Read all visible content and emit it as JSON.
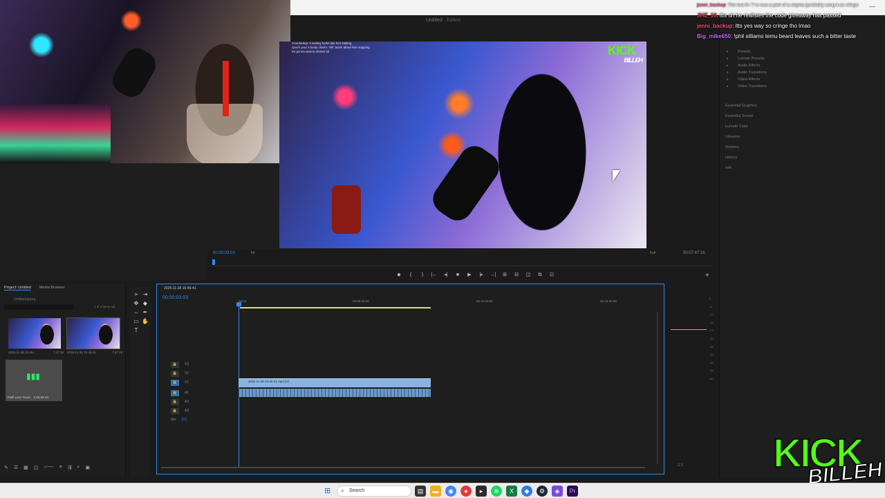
{
  "window": {
    "project_title": "Untitled",
    "edited_label": "Edited"
  },
  "chat": [
    {
      "user": "jenni_backup",
      "color": "#ff4f7a",
      "text": ": The last 6 / 7 is now a part of a stigma (probably song it as village"
    },
    {
      "user": "JHZ_16",
      "color": "#ff3c3c",
      "text": ": ltts oh he realisies the code giveaway has passed"
    },
    {
      "user": "jenni_backup",
      "color": "#ff4f7a",
      "text": ": ltts yes way so cringe tho lmao"
    },
    {
      "user": "Big_mike650",
      "color": "#c86bff",
      "text": ": !phil silliams temu beard leaves such a bitter taste"
    }
  ],
  "program_monitor": {
    "timecode": "00:00:03:03",
    "fit": "Fit",
    "resolution": "Full",
    "duration": "00:07:47:16",
    "overlay_lines": [
      "Jcrackedup: it lowkey looks like he's baking",
      "Jpoch your a lucky charm. Tell Justin about him mapping",
      "he gonna wanna stream lol"
    ],
    "logo_top": "KICK",
    "logo_sub": "BILLEH",
    "transport": [
      "◆",
      "{",
      "}",
      "|←",
      "◂|",
      "■",
      "▶",
      "|▸",
      "→|",
      "⊞",
      "⊟",
      "◫",
      "⧉",
      "⊡"
    ]
  },
  "effects": {
    "tree": [
      "Presets",
      "Lumetri Presets",
      "Audio Effects",
      "Audio Transitions",
      "Video Effects",
      "Video Transitions"
    ],
    "panels": [
      "Essential Graphics",
      "Essential Sound",
      "Lumetri Color",
      "Libraries",
      "Markers",
      "History",
      "Info"
    ]
  },
  "project": {
    "tabs": [
      "Project: Untitled",
      "Media Browser"
    ],
    "project_file": "Untitled.prproj",
    "items_count": "1 of 3 items sel.",
    "clips": [
      {
        "name": "2025-11-28 15-45-...",
        "duration": "7:47:16"
      },
      {
        "name": "2025-11-28 15-45-41",
        "duration": "7:47:16"
      }
    ],
    "audio_clip": {
      "name": "Path Less Trave...",
      "duration": "2:46:59:43"
    }
  },
  "timeline": {
    "sequence_name": "2025-11-28 15-45-41",
    "timecode": "00:00:03:03",
    "ruler": [
      "00:00",
      "00:05:00:00",
      "00:10:00:00",
      "00:15:00:00"
    ],
    "tracks": [
      {
        "label": "V3"
      },
      {
        "label": "V2"
      },
      {
        "label": "V1"
      },
      {
        "label": "A1"
      },
      {
        "label": "A2"
      },
      {
        "label": "A3"
      },
      {
        "label": "Mix",
        "value": "0.0"
      }
    ],
    "video_clip": "2025-11-28 15-45-41.mp4 [V]"
  },
  "meters": {
    "scale": [
      "0",
      "-6",
      "-12",
      "-18",
      "-24",
      "-30",
      "-36",
      "-42",
      "-48",
      "-54",
      "dB"
    ],
    "labels": "S  S"
  },
  "brand": {
    "kick": "KICK",
    "name": "BILLEH",
    "accent": "#53fc18"
  },
  "taskbar": {
    "search_label": "Search",
    "icons": [
      "task-view",
      "file-explorer",
      "chrome",
      "app-red",
      "app-dark",
      "spotify",
      "excel",
      "app-blue",
      "steam",
      "app-purple",
      "premiere-pro"
    ]
  },
  "colors": {
    "accent": "#2d8ceb",
    "clip_video": "#8ab4e0",
    "workbar": "#dde36b"
  }
}
